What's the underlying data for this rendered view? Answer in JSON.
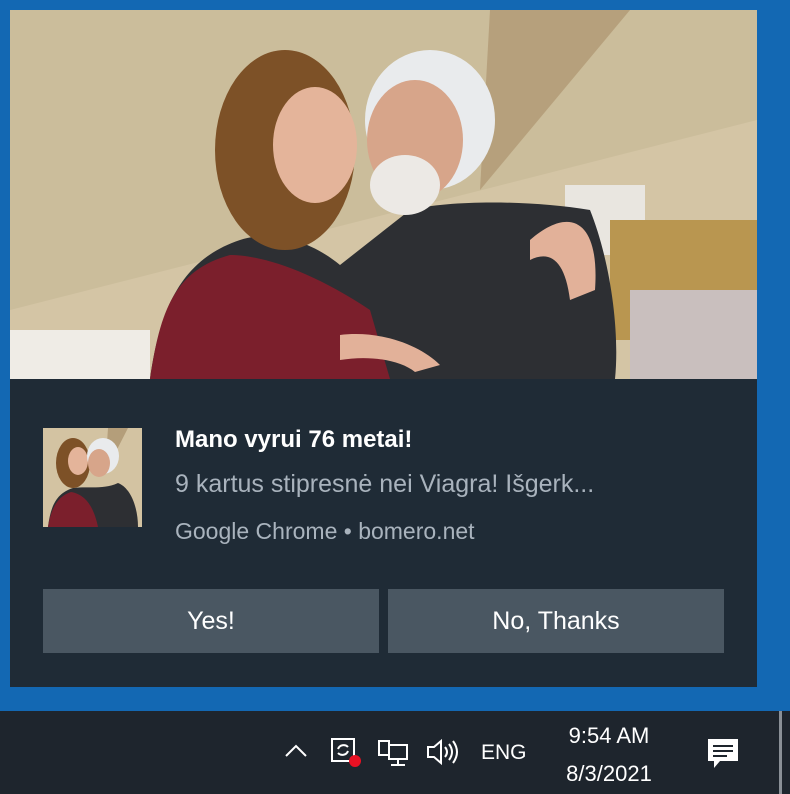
{
  "notification": {
    "title": "Mano vyrui 76 metai!",
    "message": "9 kartus stipresnė nei Viagra! Išgerk...",
    "source": "Google Chrome • bomero.net",
    "yes_label": "Yes!",
    "no_label": "No, Thanks"
  },
  "taskbar": {
    "language": "ENG",
    "time": "9:54 AM",
    "date": "8/3/2021"
  },
  "colors": {
    "desktop_accent": "#1368b3",
    "toast_background": "#1f2b36",
    "button_background": "#4a5762",
    "taskbar_background": "#1e252d"
  },
  "icons": {
    "chevron": "chevron-up-icon",
    "sync": "sync-icon",
    "network": "network-icon",
    "volume": "volume-icon",
    "action_center": "action-center-icon"
  }
}
